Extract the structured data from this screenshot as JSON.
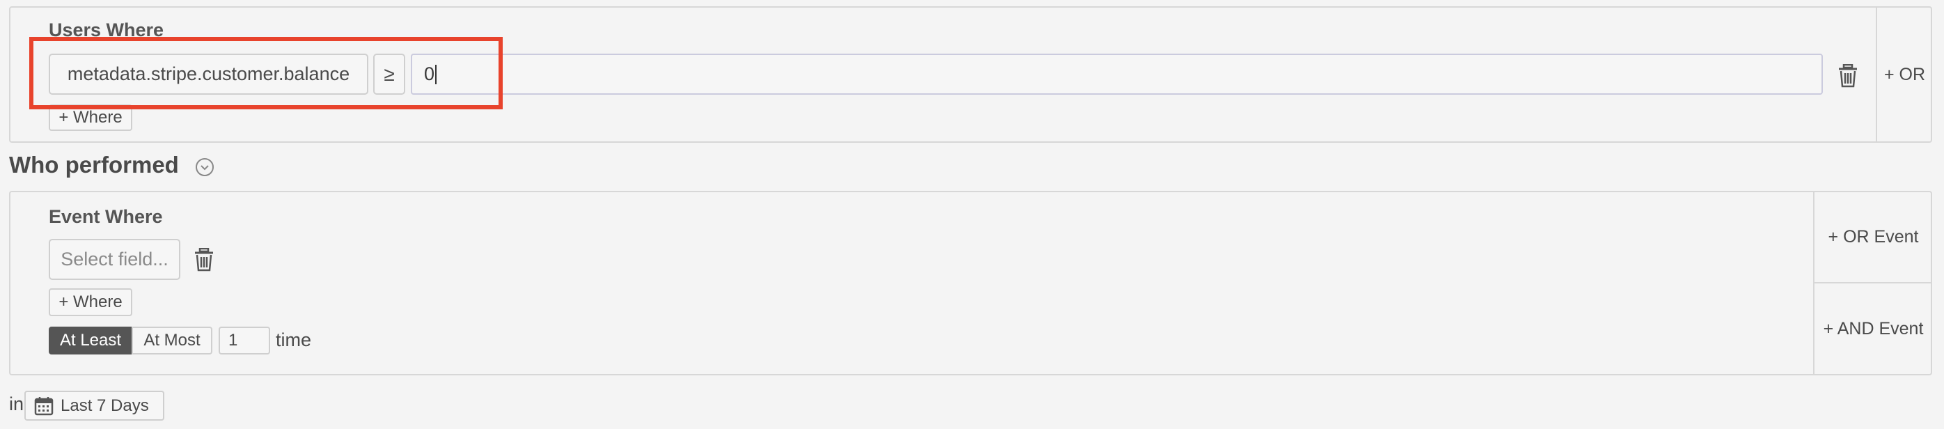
{
  "users_where": {
    "title": "Users Where",
    "field": "metadata.stripe.customer.balance",
    "operator": "≥",
    "value": "0",
    "add_where_label": "+ Where",
    "or_label": "+ OR"
  },
  "who_performed": {
    "title": "Who performed"
  },
  "event_where": {
    "title": "Event Where",
    "field_placeholder": "Select field...",
    "add_where_label": "+ Where",
    "at_least_label": "At Least",
    "at_most_label": "At Most",
    "count": "1",
    "time_label": "time",
    "or_event_label": "+ OR Event",
    "and_event_label": "+ AND Event"
  },
  "range": {
    "in_label": "in",
    "date_label": "Last 7 Days"
  },
  "colors": {
    "highlight": "#e8432c",
    "active_toggle": "#555555"
  }
}
